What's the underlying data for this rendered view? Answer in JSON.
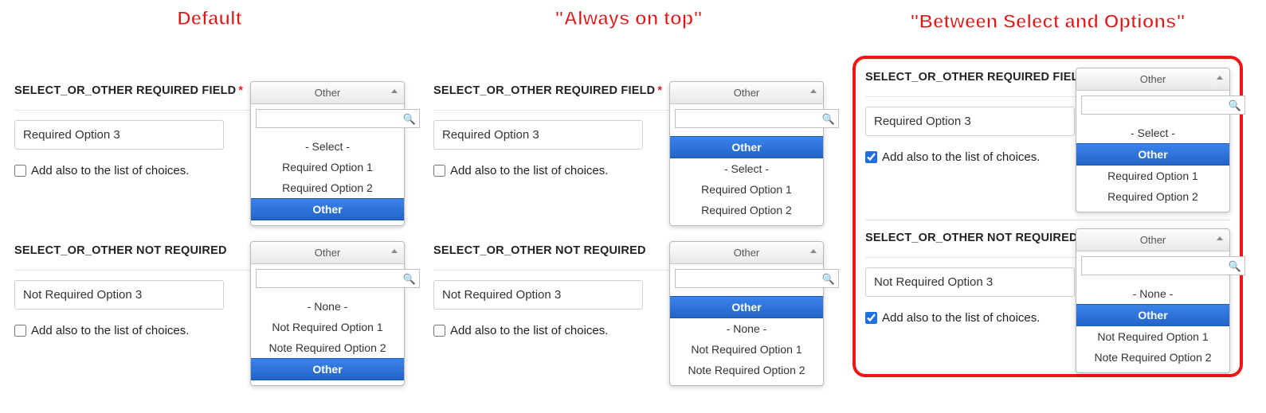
{
  "headings": {
    "c1": "Default",
    "c2": "\"Always on top\"",
    "c3": "\"Between Select and Options\""
  },
  "labels": {
    "required": "SELECT_OR_OTHER REQUIRED FIELD",
    "not_required": "SELECT_OR_OTHER NOT REQUIRED",
    "star": "*",
    "add_also": "Add also to the list of choices."
  },
  "fields": {
    "req_value": "Required Option 3",
    "nreq_value": "Not Required Option 3"
  },
  "dropdown": {
    "head": "Other",
    "req_default": [
      "- Select -",
      "Required Option 1",
      "Required Option 2",
      "Other"
    ],
    "req_top": [
      "Other",
      "- Select -",
      "Required Option 1",
      "Required Option 2"
    ],
    "req_between": [
      "- Select -",
      "Other",
      "Required Option 1",
      "Required Option 2"
    ],
    "nreq_default": [
      "- None -",
      "Not Required Option 1",
      "Note Required Option 2",
      "Other"
    ],
    "nreq_top": [
      "Other",
      "- None -",
      "Not Required Option 1",
      "Note Required Option 2"
    ],
    "nreq_between": [
      "- None -",
      "Other",
      "Not Required Option 1",
      "Note Required Option 2"
    ],
    "active_value": "Other"
  },
  "checked": {
    "c1_req": false,
    "c1_nreq": false,
    "c2_req": false,
    "c2_nreq": false,
    "c3_req": true,
    "c3_nreq": true
  }
}
